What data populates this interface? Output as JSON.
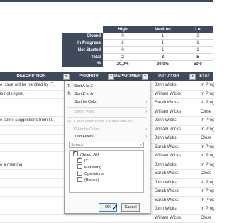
{
  "summary": {
    "headers": [
      "High",
      "Medium",
      "Lo"
    ],
    "rows": [
      {
        "label": "Closed",
        "values": [
          "0",
          "1",
          "3"
        ]
      },
      {
        "label": "In Progress",
        "values": [
          "2",
          "1",
          "1"
        ]
      },
      {
        "label": "Not Started",
        "values": [
          "0",
          "1",
          "1"
        ]
      },
      {
        "label": "Total",
        "values": [
          "2",
          "3",
          "5"
        ]
      },
      {
        "label": "%",
        "values": [
          "20,0%",
          "30,0%",
          "50,0"
        ]
      }
    ]
  },
  "main_table": {
    "headers": {
      "description": "DESCRIPTION",
      "priority": "PRIORITY",
      "department": "DEPARTMENT",
      "initiator": "INITIATOR",
      "status": "STAT"
    },
    "rows": [
      {
        "description": "e issue will be handled by IT.",
        "initiator": "John Wicks",
        "status": "In Prog"
      },
      {
        "description": "is not urgent.",
        "initiator": "William Wicks",
        "status": "In Prog"
      },
      {
        "description": "",
        "initiator": "Sarah Wicks",
        "status": "In Prog"
      },
      {
        "description": "",
        "initiator": "William Wicks",
        "status": "Close"
      },
      {
        "description": "e some suggestions from IT.",
        "initiator": "John Wicks",
        "status": "In Prog"
      },
      {
        "description": "",
        "initiator": "William Wicks",
        "status": "In Prog"
      },
      {
        "description": "",
        "initiator": "John Wicks",
        "status": "Close"
      },
      {
        "description": "",
        "initiator": "Sarah Wicks",
        "status": "In Prog"
      },
      {
        "description": "",
        "initiator": "William Wicks",
        "status": "In Prog"
      },
      {
        "description": "e a meeting",
        "initiator": "John Wicks",
        "status": "In Prog"
      },
      {
        "description": "",
        "initiator": "Sarah Wicks",
        "status": "Close"
      },
      {
        "description": "",
        "initiator": "John Wicks",
        "status": "In Prog"
      },
      {
        "description": "",
        "initiator": "Sarah Wicks",
        "status": "In Prog"
      },
      {
        "description": "",
        "initiator": "Sarah Wicks",
        "status": "In Prog"
      },
      {
        "description": "",
        "initiator": "John Wicks",
        "status": "In Prog"
      },
      {
        "description": "",
        "initiator": "William Wicks",
        "status": "Close"
      }
    ]
  },
  "filter_menu": {
    "sort_az": "Sort A to Z",
    "sort_za": "Sort Z to A",
    "sort_by_color": "Sort by Color",
    "sheet_view": "Sheet View",
    "clear_filter": "Clear Filter From \"DEPARTMENT\"",
    "filter_by_color": "Filter by Color",
    "text_filters": "Text Filters",
    "search_placeholder": "Search",
    "options": [
      {
        "label": "(Select All)",
        "checked": true
      },
      {
        "label": "IT",
        "checked": true
      },
      {
        "label": "Marketing",
        "checked": false
      },
      {
        "label": "Opertaions",
        "checked": false
      },
      {
        "label": "(Blanks)",
        "checked": false
      }
    ],
    "ok_label": "OK",
    "cancel_label": "Cancel"
  }
}
